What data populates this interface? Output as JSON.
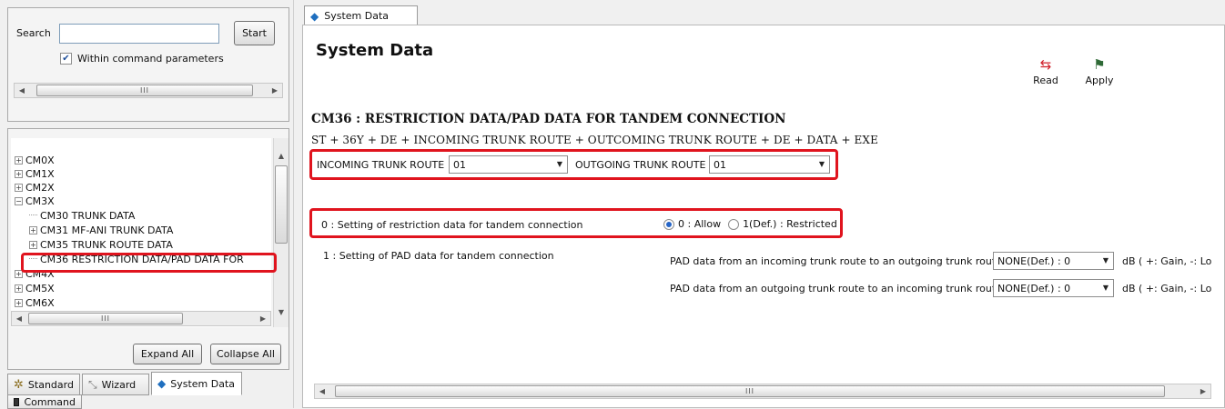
{
  "search": {
    "label": "Search",
    "value": "",
    "start_button": "Start",
    "within_checkbox_label": "Within command parameters",
    "within_checked": true
  },
  "tree": {
    "nodes": [
      {
        "label": "CM0X",
        "expander": "+"
      },
      {
        "label": "CM1X",
        "expander": "+"
      },
      {
        "label": "CM2X",
        "expander": "+"
      },
      {
        "label": "CM3X",
        "expander": "−"
      },
      {
        "label": "CM30 TRUNK DATA",
        "expander": ""
      },
      {
        "label": "CM31 MF-ANI TRUNK DATA",
        "expander": "+"
      },
      {
        "label": "CM35 TRUNK ROUTE DATA",
        "expander": "+"
      },
      {
        "label": "CM36 RESTRICTION DATA/PAD DATA FOR",
        "expander": ""
      },
      {
        "label": "CM4X",
        "expander": "+"
      },
      {
        "label": "CM5X",
        "expander": "+"
      },
      {
        "label": "CM6X",
        "expander": "+"
      }
    ],
    "expand_all": "Expand All",
    "collapse_all": "Collapse All"
  },
  "bottom_tabs": {
    "standard": "Standard",
    "wizard": "Wizard",
    "system_data": "System Data",
    "command": "Command"
  },
  "doc_tab": "System Data",
  "page_title": "System Data",
  "toolbar": {
    "read": "Read",
    "apply": "Apply"
  },
  "command": {
    "heading": "CM36 : RESTRICTION DATA/PAD DATA FOR TANDEM CONNECTION",
    "syntax": "ST + 36Y + DE + INCOMING TRUNK ROUTE + OUTCOMING TRUNK ROUTE + DE + DATA + EXE"
  },
  "routes": {
    "incoming_label": "INCOMING TRUNK ROUTE",
    "incoming_value": "01",
    "outgoing_label": "OUTGOING TRUNK ROUTE",
    "outgoing_value": "01"
  },
  "restriction": {
    "label": "0 : Setting of restriction data for tandem connection",
    "option_allow": "0 : Allow",
    "option_restricted": "1(Def.) : Restricted",
    "selected": "allow"
  },
  "pad": {
    "label": "1 : Setting of PAD data for tandem connection",
    "in_to_out_label": "PAD data from an incoming trunk route to an outgoing trunk route",
    "in_to_out_value": "NONE(Def.) : 0",
    "out_to_in_label": "PAD data from an outgoing trunk route to an incoming trunk route",
    "out_to_in_value": "NONE(Def.) : 0",
    "unit_text": "dB ( +: Gain, -: Lo"
  },
  "scroll_thumb_text": "III"
}
